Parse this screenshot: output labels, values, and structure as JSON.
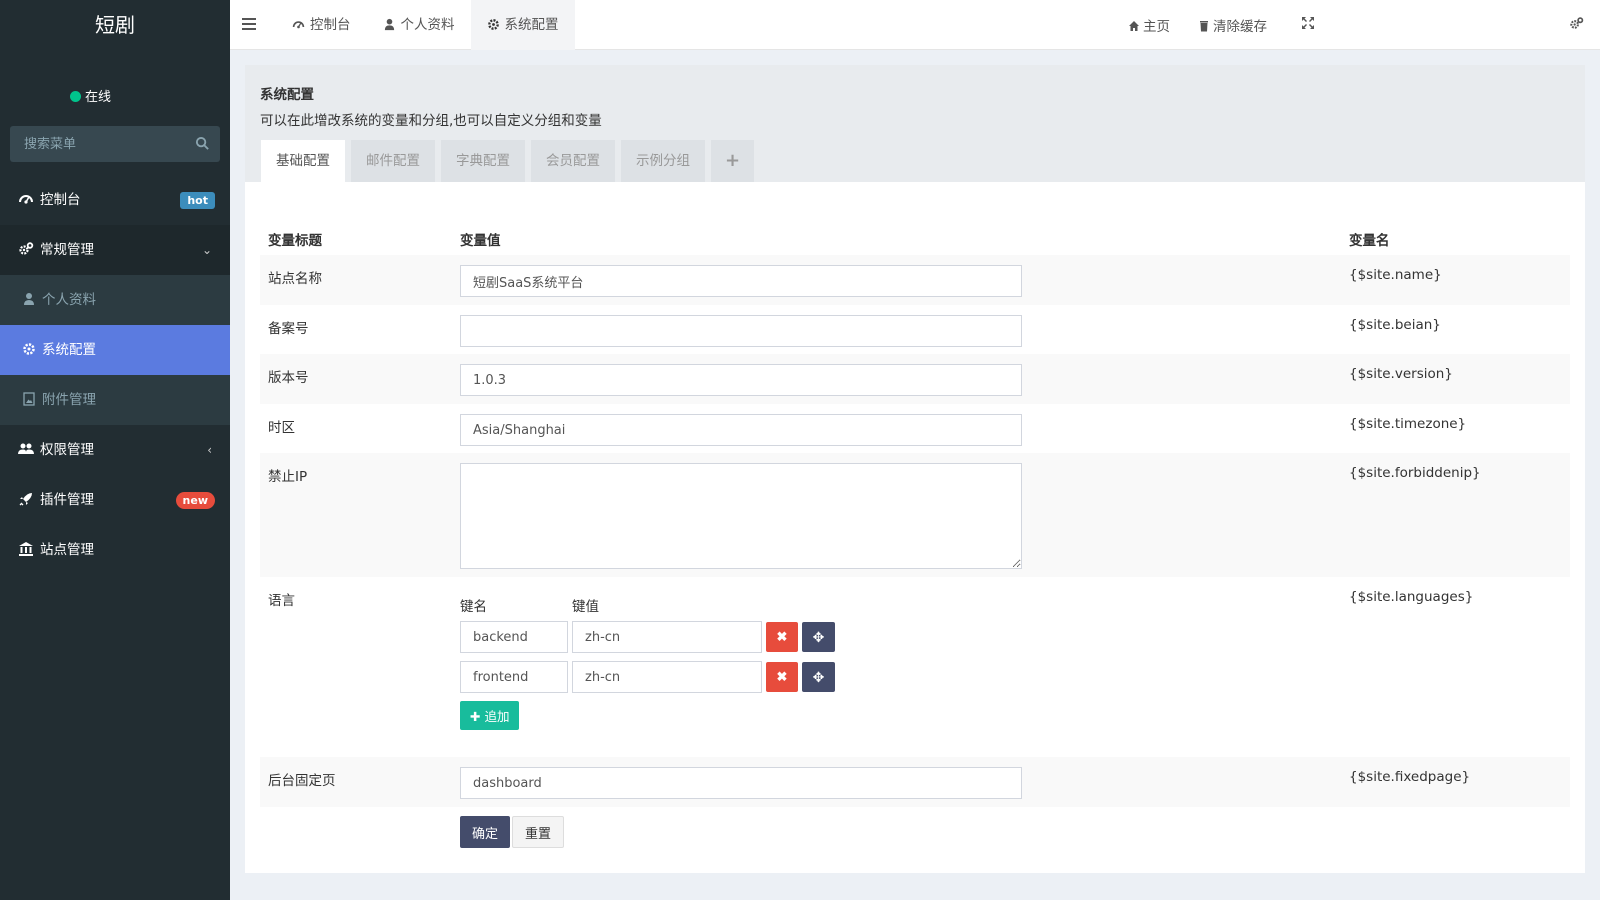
{
  "sidebar": {
    "brand": "短剧",
    "status": "在线",
    "search_placeholder": "搜索菜单",
    "menu": {
      "dashboard": {
        "label": "控制台",
        "badge": "hot"
      },
      "general": {
        "label": "常规管理"
      },
      "profile": {
        "label": "个人资料"
      },
      "config": {
        "label": "系统配置"
      },
      "attachment": {
        "label": "附件管理"
      },
      "auth": {
        "label": "权限管理"
      },
      "addon": {
        "label": "插件管理",
        "badge": "new"
      },
      "site": {
        "label": "站点管理"
      }
    }
  },
  "topnav": {
    "tabs": {
      "dashboard": "控制台",
      "profile": "个人资料",
      "config": "系统配置"
    },
    "home": "主页",
    "clear_cache": "清除缓存"
  },
  "panel": {
    "title": "系统配置",
    "desc": "可以在此增改系统的变量和分组,也可以自定义分组和变量",
    "tabs": {
      "basic": "基础配置",
      "mail": "邮件配置",
      "dict": "字典配置",
      "member": "会员配置",
      "example": "示例分组",
      "plus": "+"
    },
    "headers": {
      "title": "变量标题",
      "value": "变量值",
      "name": "变量名"
    },
    "rows": {
      "name": {
        "title": "站点名称",
        "value": "短剧SaaS系统平台",
        "var": "{$site.name}"
      },
      "beian": {
        "title": "备案号",
        "value": "",
        "var": "{$site.beian}"
      },
      "version": {
        "title": "版本号",
        "value": "1.0.3",
        "var": "{$site.version}"
      },
      "timezone": {
        "title": "时区",
        "value": "Asia/Shanghai",
        "var": "{$site.timezone}"
      },
      "forbiddenip": {
        "title": "禁止IP",
        "value": "",
        "var": "{$site.forbiddenip}"
      },
      "languages": {
        "title": "语言",
        "var": "{$site.languages}",
        "key_header": "键名",
        "value_header": "键值",
        "pairs": [
          {
            "key": "backend",
            "value": "zh-cn"
          },
          {
            "key": "frontend",
            "value": "zh-cn"
          }
        ],
        "add_label": "追加"
      },
      "fixedpage": {
        "title": "后台固定页",
        "value": "dashboard",
        "var": "{$site.fixedpage}"
      }
    },
    "ok_label": "确定",
    "reset_label": "重置"
  },
  "colors": {
    "sidebar_bg": "#222d32",
    "active_item": "#5b7be0",
    "online_dot": "#00c48c",
    "danger": "#e74c3c",
    "success": "#18bc9c",
    "primary_dark": "#444c6b",
    "hot_badge": "#3c8dbc"
  }
}
